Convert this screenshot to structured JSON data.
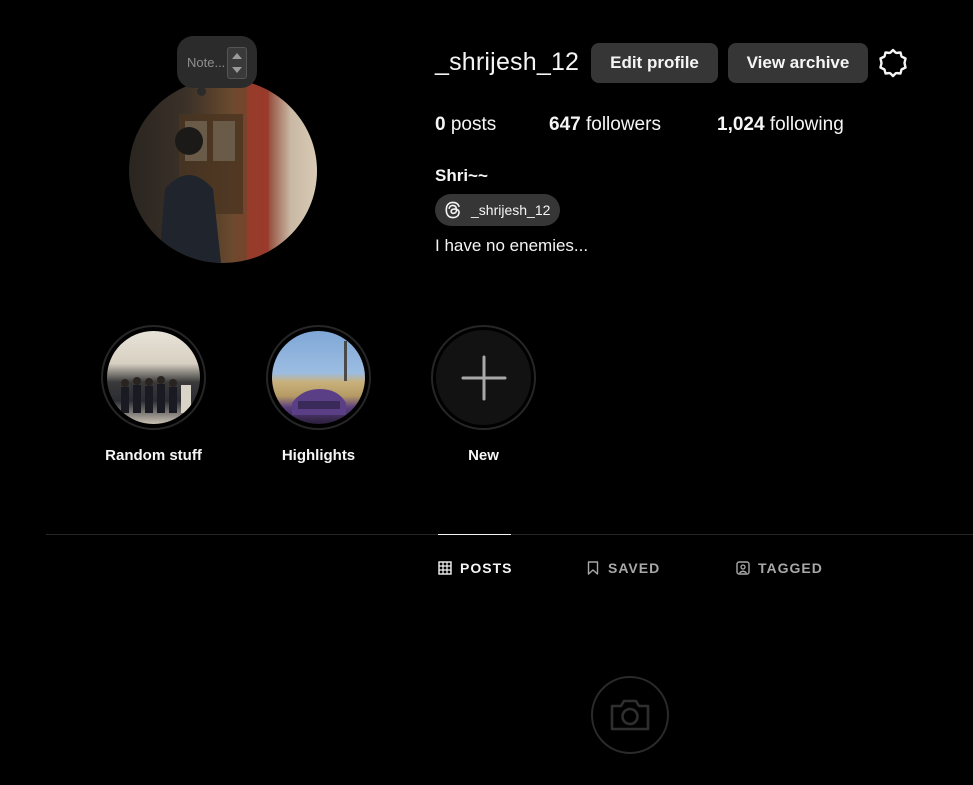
{
  "profile": {
    "username": "_shrijesh_12",
    "full_name": "Shri~~",
    "threads_handle": "_shrijesh_12",
    "bio": "I have no enemies...",
    "note_placeholder": "Note..."
  },
  "buttons": {
    "edit_profile": "Edit profile",
    "view_archive": "View archive"
  },
  "stats": {
    "posts_count": "0",
    "posts_label": "posts",
    "followers_count": "647",
    "followers_label": "followers",
    "following_count": "1,024",
    "following_label": "following"
  },
  "highlights": [
    {
      "label": "Random stuff"
    },
    {
      "label": "Highlights"
    },
    {
      "label": "New"
    }
  ],
  "tabs": {
    "posts": "POSTS",
    "saved": "SAVED",
    "tagged": "TAGGED",
    "active": "posts"
  },
  "icons": {
    "settings": "gear-icon",
    "threads": "threads-icon",
    "posts_tab": "grid-icon",
    "saved_tab": "bookmark-icon",
    "tagged_tab": "tagged-person-icon",
    "new_highlight": "plus-icon",
    "empty_state": "camera-icon"
  },
  "colors": {
    "background": "#000000",
    "button_bg": "#363636",
    "text_primary": "#f5f5f5",
    "text_secondary": "#a8a8a8",
    "divider": "#262626"
  }
}
